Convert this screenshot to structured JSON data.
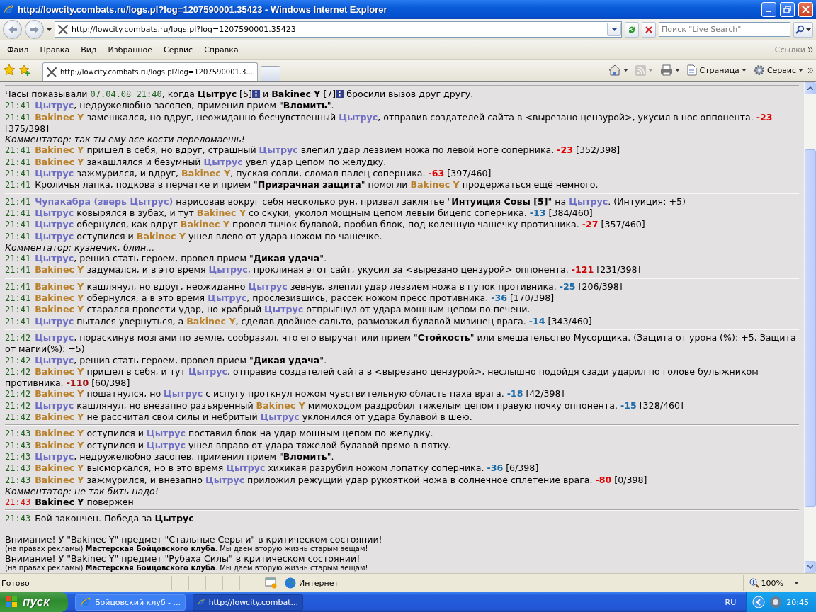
{
  "window": {
    "title": "http://lowcity.combats.ru/logs.pl?log=1207590001.35423 - Windows Internet Explorer"
  },
  "address_bar": {
    "url": "http://lowcity.combats.ru/logs.pl?log=1207590001.35423",
    "search_placeholder": "Поиск \"Live Search\""
  },
  "menu": [
    "Файл",
    "Правка",
    "Вид",
    "Избранное",
    "Сервис",
    "Справка"
  ],
  "links_label": "Ссылки",
  "tabs": [
    {
      "label": "http://lowcity.combats.ru/logs.pl?log=1207590001.3...",
      "selected": true
    }
  ],
  "command_bar": [
    {
      "kind": "home",
      "disabled": false
    },
    {
      "kind": "feeds",
      "disabled": true
    },
    {
      "kind": "print",
      "disabled": false
    },
    {
      "kind": "page",
      "label": "Страница",
      "disabled": false
    },
    {
      "kind": "tools",
      "label": "Сервис",
      "disabled": false
    }
  ],
  "log": {
    "blocks": [
      {
        "lines": [
          [
            {
              "kind": "text",
              "text": "Часы показывали "
            },
            {
              "kind": "date",
              "text": "07.04.08 21:40"
            },
            {
              "kind": "text",
              "text": ", когда "
            },
            {
              "kind": "bold",
              "text": "Цытрус"
            },
            {
              "kind": "text",
              "text": " [5]"
            },
            {
              "kind": "info"
            },
            {
              "kind": "text",
              "text": " и "
            },
            {
              "kind": "bold",
              "text": "Bakinec Y"
            },
            {
              "kind": "text",
              "text": " [7]"
            },
            {
              "kind": "info"
            },
            {
              "kind": "text",
              "text": " бросили вызов друг другу."
            }
          ],
          [
            {
              "kind": "time",
              "text": "21:41"
            },
            {
              "kind": "fighter_a",
              "text": "Цытрус"
            },
            {
              "kind": "text",
              "text": ", недружелюбно засопев, применил прием \""
            },
            {
              "kind": "bold",
              "text": "Вломить"
            },
            {
              "kind": "text",
              "text": "\"."
            }
          ],
          [
            {
              "kind": "time",
              "text": "21:41"
            },
            {
              "kind": "fighter_b",
              "text": "Bakinec Y"
            },
            {
              "kind": "text",
              "text": " замешкался, но вдруг, неожиданно бесчувственный "
            },
            {
              "kind": "fighter_a",
              "text": "Цытрус"
            },
            {
              "kind": "text",
              "text": ", отправив создателей сайта в <вырезано цензурой>, укусил в нос оппонента. "
            },
            {
              "kind": "damage",
              "text": "-23",
              "color": "#e00000"
            },
            {
              "kind": "text",
              "text": " [375/398]"
            }
          ],
          [
            {
              "kind": "comment",
              "text": "Комментатор: так ты ему все кости переломаешь!"
            }
          ],
          [
            {
              "kind": "time",
              "text": "21:41"
            },
            {
              "kind": "fighter_b",
              "text": "Bakinec Y"
            },
            {
              "kind": "text",
              "text": " пришел в себя, но вдруг, страшный "
            },
            {
              "kind": "fighter_a",
              "text": "Цытрус"
            },
            {
              "kind": "text",
              "text": " влепил удар лезвием ножа по левой ноге соперника. "
            },
            {
              "kind": "damage",
              "text": "-23",
              "color": "#e00000"
            },
            {
              "kind": "text",
              "text": " [352/398]"
            }
          ],
          [
            {
              "kind": "time",
              "text": "21:41"
            },
            {
              "kind": "fighter_b",
              "text": "Bakinec Y"
            },
            {
              "kind": "text",
              "text": " закашлялся и безумный "
            },
            {
              "kind": "fighter_a",
              "text": "Цытрус"
            },
            {
              "kind": "text",
              "text": " увел удар цепом по желудку."
            }
          ],
          [
            {
              "kind": "time",
              "text": "21:41"
            },
            {
              "kind": "fighter_a",
              "text": "Цытрус"
            },
            {
              "kind": "text",
              "text": " зажмурился, и вдруг, "
            },
            {
              "kind": "fighter_b",
              "text": "Bakinec Y"
            },
            {
              "kind": "text",
              "text": ", пуская сопли, сломал палец соперника. "
            },
            {
              "kind": "damage",
              "text": "-63",
              "color": "#e00000"
            },
            {
              "kind": "text",
              "text": " [397/460]"
            }
          ],
          [
            {
              "kind": "time",
              "text": "21:41"
            },
            {
              "kind": "text",
              "text": "Кроличья лапка, подкова в перчатке и прием \""
            },
            {
              "kind": "bold",
              "text": "Призрачная защита"
            },
            {
              "kind": "text",
              "text": "\" помогли "
            },
            {
              "kind": "fighter_b",
              "text": "Bakinec Y"
            },
            {
              "kind": "text",
              "text": " продержаться ещё немного."
            }
          ]
        ]
      },
      {
        "lines": [
          [
            {
              "kind": "time",
              "text": "21:41"
            },
            {
              "kind": "fighter_a",
              "text": "Чупакабра (зверь Цытрус)"
            },
            {
              "kind": "text",
              "text": " нарисовав вокруг себя несколько рун, призвал заклятье \""
            },
            {
              "kind": "bold",
              "text": "Интуиция Совы [5]"
            },
            {
              "kind": "text",
              "text": "\" на "
            },
            {
              "kind": "fighter_a",
              "text": "Цытрус"
            },
            {
              "kind": "text",
              "text": ". (Интуиция: +5)"
            }
          ],
          [
            {
              "kind": "time",
              "text": "21:41"
            },
            {
              "kind": "fighter_a",
              "text": "Цытрус"
            },
            {
              "kind": "text",
              "text": " ковырялся в зубах, и тут "
            },
            {
              "kind": "fighter_b",
              "text": "Bakinec Y"
            },
            {
              "kind": "text",
              "text": " со скуки, уколол мощным цепом левый бицепс соперника. "
            },
            {
              "kind": "damage",
              "text": "-13",
              "color": "#1a6aa8"
            },
            {
              "kind": "text",
              "text": " [384/460]"
            }
          ],
          [
            {
              "kind": "time",
              "text": "21:41"
            },
            {
              "kind": "fighter_a",
              "text": "Цытрус"
            },
            {
              "kind": "text",
              "text": " обернулся, как вдруг "
            },
            {
              "kind": "fighter_b",
              "text": "Bakinec Y"
            },
            {
              "kind": "text",
              "text": " провел тычок булавой, пробив блок, под коленную чашечку противника. "
            },
            {
              "kind": "damage",
              "text": "-27",
              "color": "#e00000"
            },
            {
              "kind": "text",
              "text": " [357/460]"
            }
          ],
          [
            {
              "kind": "time",
              "text": "21:41"
            },
            {
              "kind": "fighter_a",
              "text": "Цытрус"
            },
            {
              "kind": "text",
              "text": " оступился и "
            },
            {
              "kind": "fighter_b",
              "text": "Bakinec Y"
            },
            {
              "kind": "text",
              "text": " ушел влево от удара ножом по чашечке."
            }
          ],
          [
            {
              "kind": "comment",
              "text": "Комментатор: кузнечик, блин..."
            }
          ],
          [
            {
              "kind": "time",
              "text": "21:41"
            },
            {
              "kind": "fighter_a",
              "text": "Цытрус"
            },
            {
              "kind": "text",
              "text": ", решив стать героем, провел прием \""
            },
            {
              "kind": "bold",
              "text": "Дикая удача"
            },
            {
              "kind": "text",
              "text": "\"."
            }
          ],
          [
            {
              "kind": "time",
              "text": "21:41"
            },
            {
              "kind": "fighter_b",
              "text": "Bakinec Y"
            },
            {
              "kind": "text",
              "text": " задумался, и в это время "
            },
            {
              "kind": "fighter_a",
              "text": "Цытрус"
            },
            {
              "kind": "text",
              "text": ", проклиная этот сайт, укусил за <вырезано цензурой> оппонента. "
            },
            {
              "kind": "damage",
              "text": "-121",
              "color": "#c80000"
            },
            {
              "kind": "text",
              "text": " [231/398]"
            }
          ]
        ]
      },
      {
        "lines": [
          [
            {
              "kind": "time",
              "text": "21:41"
            },
            {
              "kind": "fighter_b",
              "text": "Bakinec Y"
            },
            {
              "kind": "text",
              "text": " кашлянул, но вдруг, неожиданно "
            },
            {
              "kind": "fighter_a",
              "text": "Цытрус"
            },
            {
              "kind": "text",
              "text": " зевнув, влепил удар лезвием ножа в пупок противника. "
            },
            {
              "kind": "damage",
              "text": "-25",
              "color": "#1a6aa8"
            },
            {
              "kind": "text",
              "text": " [206/398]"
            }
          ],
          [
            {
              "kind": "time",
              "text": "21:41"
            },
            {
              "kind": "fighter_b",
              "text": "Bakinec Y"
            },
            {
              "kind": "text",
              "text": " обернулся, а в это время "
            },
            {
              "kind": "fighter_a",
              "text": "Цытрус"
            },
            {
              "kind": "text",
              "text": ", прослезившись, рассек ножом пресс противника. "
            },
            {
              "kind": "damage",
              "text": "-36",
              "color": "#1a6aa8"
            },
            {
              "kind": "text",
              "text": " [170/398]"
            }
          ],
          [
            {
              "kind": "time",
              "text": "21:41"
            },
            {
              "kind": "fighter_b",
              "text": "Bakinec Y"
            },
            {
              "kind": "text",
              "text": " старался провести удар, но храбрый "
            },
            {
              "kind": "fighter_a",
              "text": "Цытрус"
            },
            {
              "kind": "text",
              "text": " отпрыгнул от удара мощным цепом по печени."
            }
          ],
          [
            {
              "kind": "time",
              "text": "21:41"
            },
            {
              "kind": "fighter_a",
              "text": "Цытрус"
            },
            {
              "kind": "text",
              "text": " пытался увернуться, а "
            },
            {
              "kind": "fighter_b",
              "text": "Bakinec Y"
            },
            {
              "kind": "text",
              "text": ", сделав двойное сальто, размозжил булавой мизинец врага. "
            },
            {
              "kind": "damage",
              "text": "-14",
              "color": "#1a6aa8"
            },
            {
              "kind": "text",
              "text": " [343/460]"
            }
          ]
        ]
      },
      {
        "lines": [
          [
            {
              "kind": "time",
              "text": "21:42"
            },
            {
              "kind": "fighter_a",
              "text": "Цытрус"
            },
            {
              "kind": "text",
              "text": ", пораскинув мозгами по земле, сообразил, что его выручат или прием \""
            },
            {
              "kind": "bold",
              "text": "Стойкость"
            },
            {
              "kind": "text",
              "text": "\" или вмешательство Мусорщика. (Защита от урона (%): +5, Защита от магии(%): +5)"
            }
          ],
          [
            {
              "kind": "time",
              "text": "21:42"
            },
            {
              "kind": "fighter_a",
              "text": "Цытрус"
            },
            {
              "kind": "text",
              "text": ", решив стать героем, провел прием \""
            },
            {
              "kind": "bold",
              "text": "Дикая удача"
            },
            {
              "kind": "text",
              "text": "\"."
            }
          ],
          [
            {
              "kind": "time",
              "text": "21:42"
            },
            {
              "kind": "fighter_b",
              "text": "Bakinec Y"
            },
            {
              "kind": "text",
              "text": " пришел в себя, и тут "
            },
            {
              "kind": "fighter_a",
              "text": "Цытрус"
            },
            {
              "kind": "text",
              "text": ", отправив создателей сайта в <вырезано цензурой>, неслышно подойдя сзади ударил по голове булыжником противника. "
            },
            {
              "kind": "damage",
              "text": "-110",
              "color": "#a01010"
            },
            {
              "kind": "text",
              "text": " [60/398]"
            }
          ],
          [
            {
              "kind": "time",
              "text": "21:42"
            },
            {
              "kind": "fighter_b",
              "text": "Bakinec Y"
            },
            {
              "kind": "text",
              "text": " пошатнулся, но "
            },
            {
              "kind": "fighter_a",
              "text": "Цытрус"
            },
            {
              "kind": "text",
              "text": " с испугу проткнул ножом чувствительную область паха врага. "
            },
            {
              "kind": "damage",
              "text": "-18",
              "color": "#1a6aa8"
            },
            {
              "kind": "text",
              "text": " [42/398]"
            }
          ],
          [
            {
              "kind": "time",
              "text": "21:42"
            },
            {
              "kind": "fighter_a",
              "text": "Цытрус"
            },
            {
              "kind": "text",
              "text": " кашлянул, но внезапно разъяренный "
            },
            {
              "kind": "fighter_b",
              "text": "Bakinec Y"
            },
            {
              "kind": "text",
              "text": " мимоходом раздробил тяжелым цепом правую почку оппонента. "
            },
            {
              "kind": "damage",
              "text": "-15",
              "color": "#1a6aa8"
            },
            {
              "kind": "text",
              "text": " [328/460]"
            }
          ],
          [
            {
              "kind": "time",
              "text": "21:42"
            },
            {
              "kind": "fighter_b",
              "text": "Bakinec Y"
            },
            {
              "kind": "text",
              "text": " не рассчитал свои силы и небритый "
            },
            {
              "kind": "fighter_a",
              "text": "Цытрус"
            },
            {
              "kind": "text",
              "text": " уклонился от удара булавой в шею."
            }
          ]
        ]
      },
      {
        "lines": [
          [
            {
              "kind": "time",
              "text": "21:43"
            },
            {
              "kind": "fighter_b",
              "text": "Bakinec Y"
            },
            {
              "kind": "text",
              "text": " оступился и "
            },
            {
              "kind": "fighter_a",
              "text": "Цытрус"
            },
            {
              "kind": "text",
              "text": " поставил блок на удар мощным цепом по желудку."
            }
          ],
          [
            {
              "kind": "time",
              "text": "21:43"
            },
            {
              "kind": "fighter_b",
              "text": "Bakinec Y"
            },
            {
              "kind": "text",
              "text": " оступился и "
            },
            {
              "kind": "fighter_a",
              "text": "Цытрус"
            },
            {
              "kind": "text",
              "text": " ушел вправо от удара тяжелой булавой прямо в пятку."
            }
          ],
          [
            {
              "kind": "time",
              "text": "21:43"
            },
            {
              "kind": "fighter_a",
              "text": "Цытрус"
            },
            {
              "kind": "text",
              "text": ", недружелюбно засопев, применил прием \""
            },
            {
              "kind": "bold",
              "text": "Вломить"
            },
            {
              "kind": "text",
              "text": "\"."
            }
          ],
          [
            {
              "kind": "time",
              "text": "21:43"
            },
            {
              "kind": "fighter_b",
              "text": "Bakinec Y"
            },
            {
              "kind": "text",
              "text": " высморкался, но в это время "
            },
            {
              "kind": "fighter_a",
              "text": "Цытрус"
            },
            {
              "kind": "text",
              "text": " хихикая разрубил ножом лопатку соперника. "
            },
            {
              "kind": "damage",
              "text": "-36",
              "color": "#1a6aa8"
            },
            {
              "kind": "text",
              "text": " [6/398]"
            }
          ],
          [
            {
              "kind": "time",
              "text": "21:43"
            },
            {
              "kind": "fighter_b",
              "text": "Bakinec Y"
            },
            {
              "kind": "text",
              "text": " зажмурился, и внезапно "
            },
            {
              "kind": "fighter_a",
              "text": "Цытрус"
            },
            {
              "kind": "text",
              "text": " приложил режущий удар рукояткой ножа в солнечное сплетение врага. "
            },
            {
              "kind": "damage",
              "text": "-80",
              "color": "#e00000"
            },
            {
              "kind": "text",
              "text": " [0/398]"
            }
          ],
          [
            {
              "kind": "comment",
              "text": "Комментатор: не так бить надо!"
            }
          ],
          [
            {
              "kind": "alert_time",
              "text": "21:43"
            },
            {
              "kind": "bold",
              "text": "Bakinec Y"
            },
            {
              "kind": "text",
              "text": " повержен"
            }
          ]
        ]
      },
      {
        "lines": [
          [
            {
              "kind": "time",
              "text": "21:43"
            },
            {
              "kind": "text",
              "text": "Бой закончен. Победа за "
            },
            {
              "kind": "bold",
              "text": "Цытрус"
            }
          ]
        ]
      }
    ],
    "notices": [
      {
        "kind": "warning",
        "text": "Внимание! У \"Bakinec Y\" предмет \"Стальные Серьги\" в критическом состоянии!"
      },
      {
        "kind": "ad",
        "text": "(на правах рекламы) **Мастерская Бойцовского клуба**. Мы даем вторую жизнь старым вещам!"
      },
      {
        "kind": "warning",
        "text": "Внимание! У \"Bakinec Y\" предмет \"Рубаха Силы\" в критическом состоянии!"
      },
      {
        "kind": "ad",
        "text": "(на правах рекламы) **Мастерская Бойцовского клуба**. Мы даем вторую жизнь старым вещам!"
      }
    ]
  },
  "status_bar": {
    "text": "Готово",
    "zone": "Интернет",
    "zoom": "100%"
  },
  "taskbar": {
    "start": "пуск",
    "tasks": [
      {
        "label": "Бойцовский клуб - ...",
        "selected": false
      },
      {
        "label": "http://lowcity.combat...",
        "selected": true
      }
    ],
    "language": "RU",
    "clock": "20:45"
  }
}
